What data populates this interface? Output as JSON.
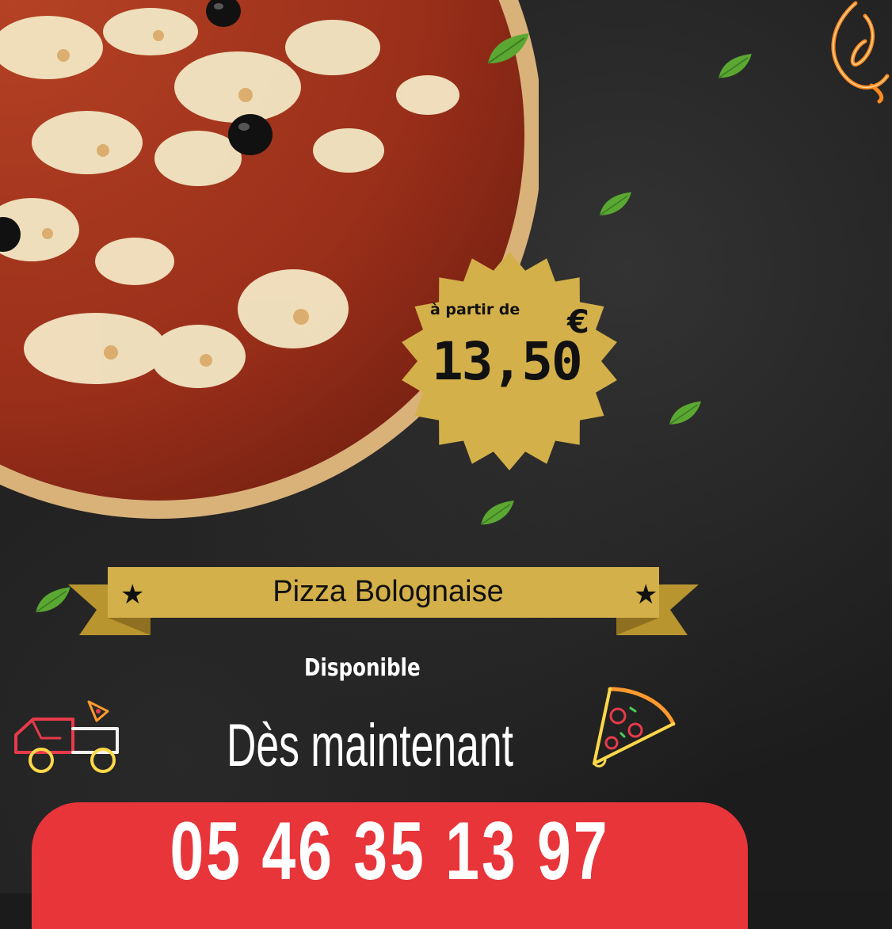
{
  "promo": {
    "price_prefix": "à partir de",
    "price_value": "13,50",
    "price_currency": "€",
    "pizza_name": "Pizza Bolognaise",
    "star_glyph": "★",
    "availability_label": "Disponible",
    "availability_time": "Dès maintenant",
    "phone": "05 46 35 13 97"
  },
  "colors": {
    "background": "#1c1c1c",
    "gold": "#d4b04a",
    "red": "#e8353a",
    "leaf": "#5aa832",
    "neon_orange": "#ff8a1e"
  },
  "icons": [
    "pizza-photo",
    "basil-leaf-icon",
    "flame-logo-icon",
    "delivery-truck-icon",
    "pizza-slice-icon",
    "star-icon"
  ]
}
